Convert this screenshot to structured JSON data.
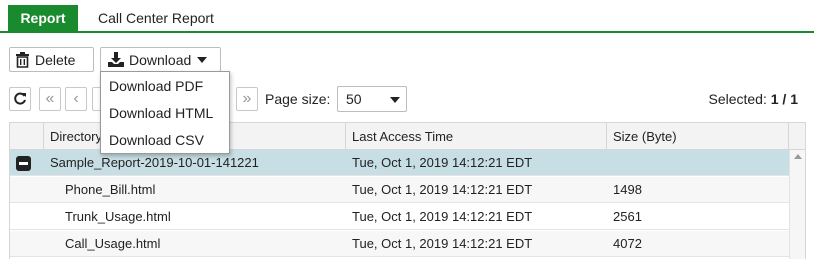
{
  "tabs": [
    {
      "label": "Report",
      "active": true
    },
    {
      "label": "Call Center Report",
      "active": false
    }
  ],
  "toolbar": {
    "delete_label": "Delete",
    "download_label": "Download"
  },
  "download_menu": {
    "items": [
      "Download PDF",
      "Download HTML",
      "Download CSV"
    ]
  },
  "pagination": {
    "page_size_label": "Page size:",
    "page_size_value": "50",
    "selected_label": "Selected:",
    "selected_value": "1 / 1"
  },
  "table": {
    "columns": [
      "Directory",
      "Last Access Time",
      "Size (Byte)"
    ],
    "rows": [
      {
        "name": "Sample_Report-2019-10-01-141221",
        "time": "Tue, Oct 1, 2019 14:12:21 EDT",
        "size": "",
        "group": true,
        "selected": true
      },
      {
        "name": "Phone_Bill.html",
        "time": "Tue, Oct 1, 2019 14:12:21 EDT",
        "size": "1498"
      },
      {
        "name": "Trunk_Usage.html",
        "time": "Tue, Oct 1, 2019 14:12:21 EDT",
        "size": "2561"
      },
      {
        "name": "Call_Usage.html",
        "time": "Tue, Oct 1, 2019 14:12:21 EDT",
        "size": "4072"
      }
    ]
  },
  "colors": {
    "accent": "#1a8a2e",
    "selected_row": "#c7dfe4"
  },
  "icons": [
    "trash-icon",
    "download-icon",
    "caret-down-icon",
    "refresh-icon",
    "first-page-icon",
    "prev-page-icon",
    "last-page-icon",
    "collapse-icon",
    "scroll-up-icon"
  ]
}
